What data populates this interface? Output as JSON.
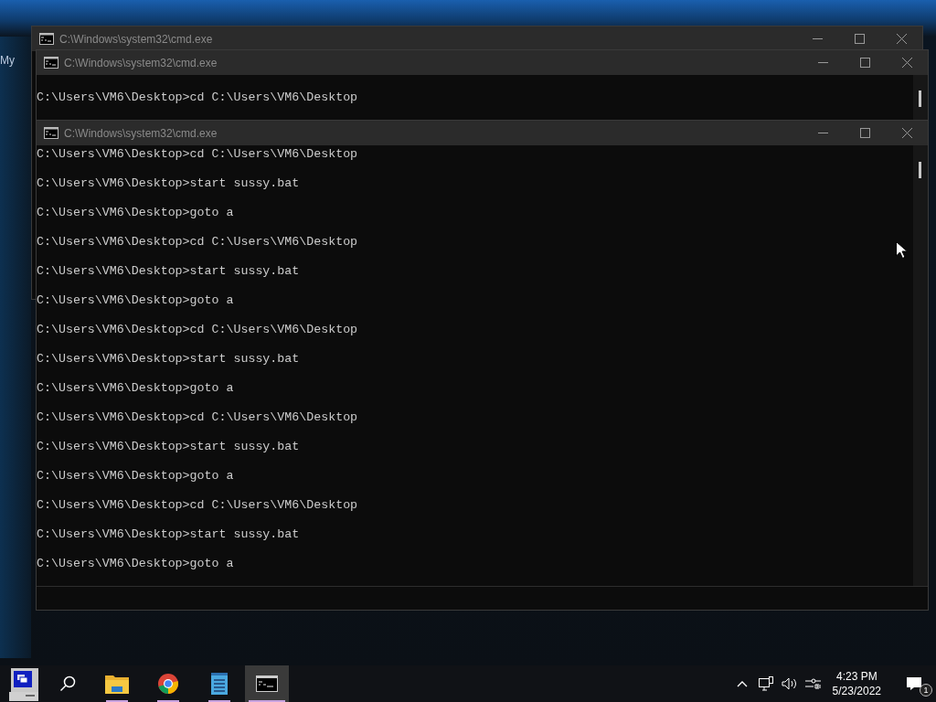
{
  "desktop": {
    "icon_label": "My"
  },
  "windows": [
    {
      "title": "C:\\Windows\\system32\\cmd.exe"
    },
    {
      "title": "C:\\Windows\\system32\\cmd.exe",
      "lines": [
        "C:\\Users\\VM6\\Desktop>cd C:\\Users\\VM6\\Desktop"
      ]
    },
    {
      "title": "C:\\Windows\\system32\\cmd.exe",
      "lines": [
        "C:\\Users\\VM6\\Desktop>cd C:\\Users\\VM6\\Desktop",
        "C:\\Users\\VM6\\Desktop>start sussy.bat",
        "C:\\Users\\VM6\\Desktop>goto a",
        "C:\\Users\\VM6\\Desktop>cd C:\\Users\\VM6\\Desktop",
        "C:\\Users\\VM6\\Desktop>start sussy.bat",
        "C:\\Users\\VM6\\Desktop>goto a",
        "C:\\Users\\VM6\\Desktop>cd C:\\Users\\VM6\\Desktop",
        "C:\\Users\\VM6\\Desktop>start sussy.bat",
        "C:\\Users\\VM6\\Desktop>goto a",
        "C:\\Users\\VM6\\Desktop>cd C:\\Users\\VM6\\Desktop",
        "C:\\Users\\VM6\\Desktop>start sussy.bat",
        "C:\\Users\\VM6\\Desktop>goto a",
        "C:\\Users\\VM6\\Desktop>cd C:\\Users\\VM6\\Desktop",
        "C:\\Users\\VM6\\Desktop>start sussy.bat",
        "C:\\Users\\VM6\\Desktop>goto a"
      ]
    }
  ],
  "taskbar": {
    "apps": [
      {
        "kind": "explorer",
        "running": true,
        "selected": false
      },
      {
        "kind": "chrome",
        "running": true,
        "selected": false
      },
      {
        "kind": "notepad",
        "running": true,
        "selected": false
      },
      {
        "kind": "cmd",
        "running": true,
        "selected": true
      }
    ],
    "clock": {
      "time": "4:23 PM",
      "date": "5/23/2022"
    },
    "notification_count": "1"
  }
}
